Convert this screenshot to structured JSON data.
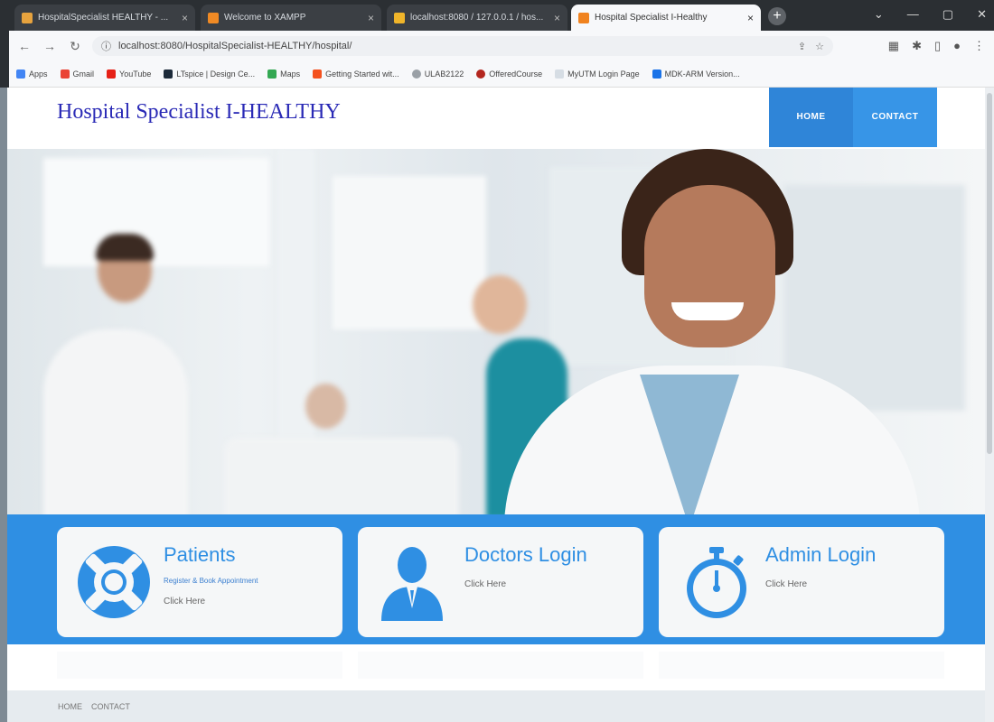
{
  "browser": {
    "tabs": [
      {
        "label": "HospitalSpecialist HEALTHY - ...",
        "active": false
      },
      {
        "label": "Welcome to XAMPP",
        "active": false
      },
      {
        "label": "localhost:8080 / 127.0.0.1 / hos...",
        "active": false
      },
      {
        "label": "Hospital Specialist I-Healthy",
        "active": true
      }
    ],
    "url": "localhost:8080/HospitalSpecialist-HEALTHY/hospital/",
    "bookmarks": [
      "Apps",
      "Gmail",
      "YouTube",
      "LTspice | Design Ce...",
      "Maps",
      "Getting Started wit...",
      "ULAB2122",
      "OfferedCourse",
      "MyUTM Login Page",
      "MDK-ARM Version..."
    ]
  },
  "site": {
    "title": "Hospital Specialist I-HEALTHY",
    "menu": {
      "home": "HOME",
      "contact": "CONTACT"
    }
  },
  "cards": [
    {
      "title": "Patients",
      "subtitle": "Register & Book Appointment",
      "link": "Click Here",
      "icon": "lifebuoy-icon"
    },
    {
      "title": "Doctors Login",
      "subtitle": "",
      "link": "Click Here",
      "icon": "doctor-icon"
    },
    {
      "title": "Admin Login",
      "subtitle": "",
      "link": "Click Here",
      "icon": "stopwatch-icon"
    }
  ],
  "footer": {
    "home": "HOME",
    "contact": "CONTACT"
  },
  "colors": {
    "primary": "#2f8fe3",
    "menu": "#2f85d8",
    "title": "#2a2ab6"
  }
}
